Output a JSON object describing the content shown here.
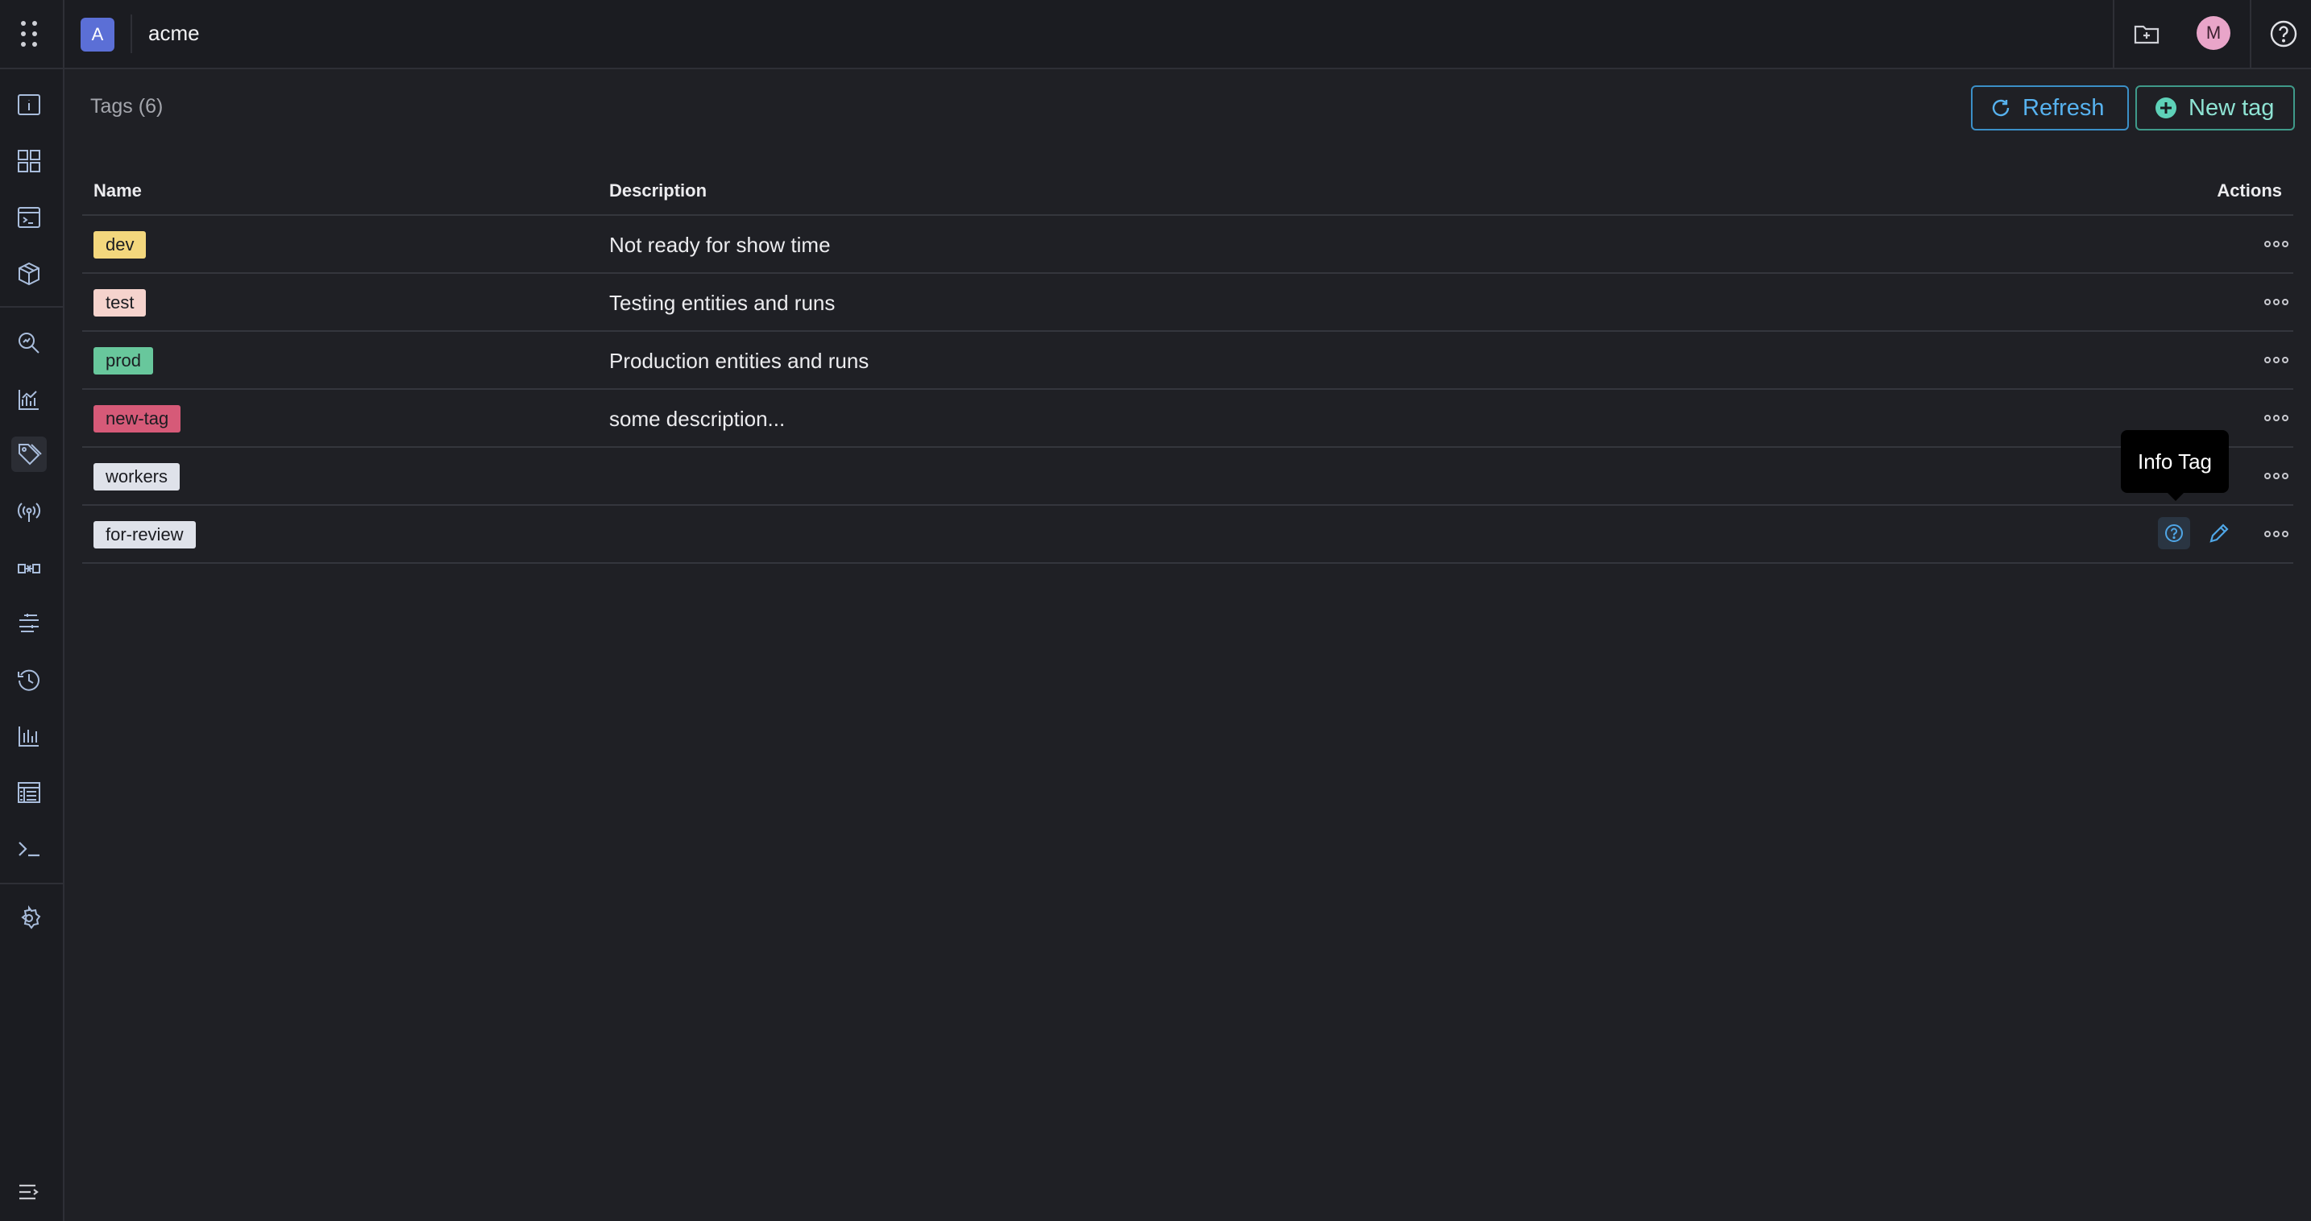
{
  "topbar": {
    "org_initial": "A",
    "org_name": "acme",
    "user_initial": "M"
  },
  "page": {
    "title": "Tags (6)",
    "refresh_label": "Refresh",
    "new_tag_label": "New tag"
  },
  "table": {
    "headers": {
      "name": "Name",
      "description": "Description",
      "actions": "Actions"
    },
    "rows": [
      {
        "tag": "dev",
        "color": "#f3d77d",
        "description": "Not ready for show time"
      },
      {
        "tag": "test",
        "color": "#f5d3cd",
        "description": "Testing entities and runs"
      },
      {
        "tag": "prod",
        "color": "#68c79c",
        "description": "Production entities and runs"
      },
      {
        "tag": "new-tag",
        "color": "#d65a78",
        "description": "some description..."
      },
      {
        "tag": "workers",
        "color": "#dfe2ea",
        "description": ""
      },
      {
        "tag": "for-review",
        "color": "#dfe2ea",
        "description": ""
      }
    ]
  },
  "tooltip": {
    "text": "Info Tag"
  },
  "icons": {
    "sidebar": [
      "info-icon",
      "dashboard-icon",
      "terminal-window-icon",
      "cube-icon",
      "search-analytics-icon",
      "chart-icon",
      "tag-icon",
      "broadcast-icon",
      "connection-icon",
      "filter-lines-icon",
      "history-icon",
      "bar-chart-icon",
      "table-icon",
      "console-icon",
      "settings-icon",
      "collapse-menu-icon"
    ]
  },
  "colors": {
    "background": "#1f2025",
    "refresh_accent": "#57b2ef",
    "new_tag_accent": "#8ee3d3"
  }
}
